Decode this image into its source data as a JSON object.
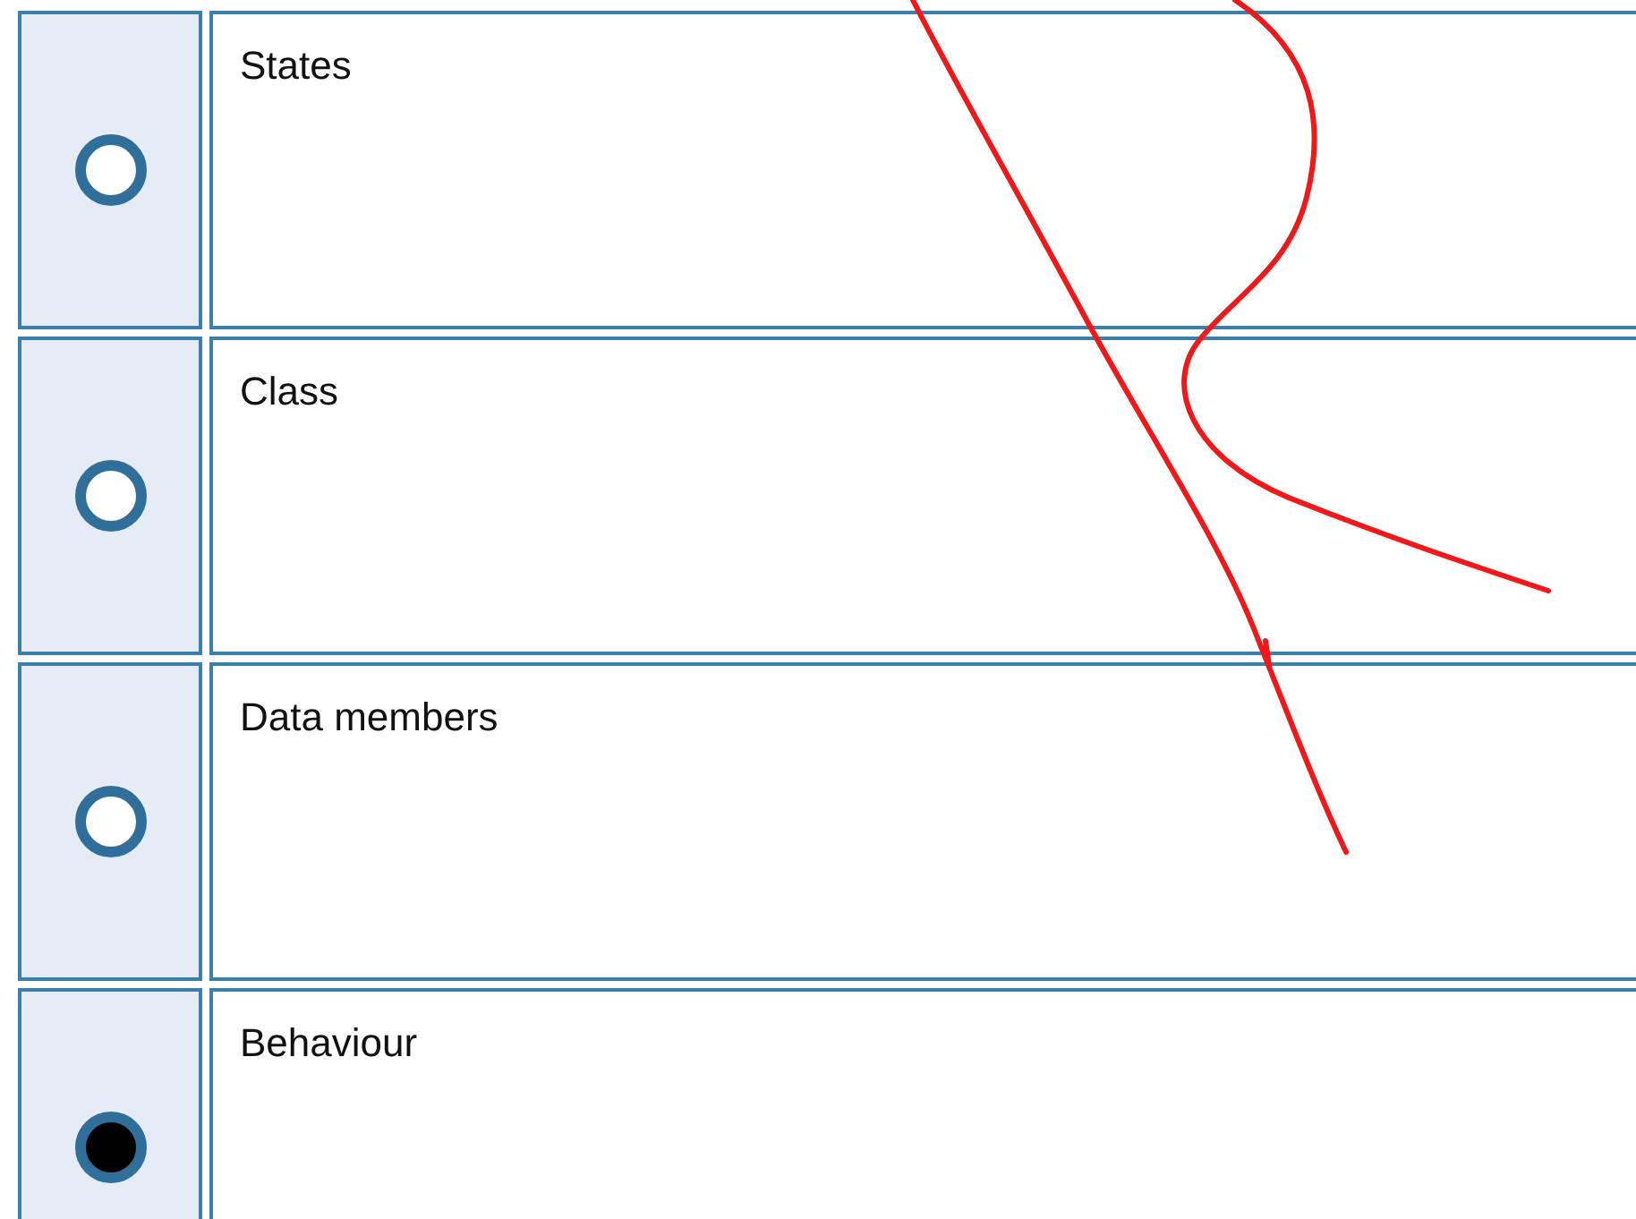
{
  "options": [
    {
      "label": "States",
      "selected": false
    },
    {
      "label": "Class",
      "selected": false
    },
    {
      "label": "Data members",
      "selected": false
    },
    {
      "label": "Behaviour",
      "selected": true
    }
  ]
}
